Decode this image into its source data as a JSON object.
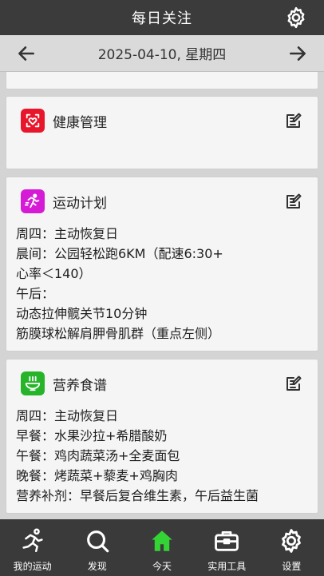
{
  "header": {
    "title": "每日关注"
  },
  "datebar": {
    "date": "2025-04-10, 星期四"
  },
  "cards": [
    {
      "title": "健康管理",
      "badge_color": "#e8162a",
      "lines": []
    },
    {
      "title": "运动计划",
      "badge_color": "#d61bd6",
      "lines": [
        "周四：主动恢复日",
        "晨间：公园轻松跑6KM（配速6:30+",
        "心率＜140）",
        "午后：",
        "动态拉伸髋关节10分钟",
        "筋膜球松解肩胛骨肌群（重点左侧）"
      ]
    },
    {
      "title": "营养食谱",
      "badge_color": "#27b42b",
      "lines": [
        "周四：主动恢复日",
        "早餐：水果沙拉+希腊酸奶",
        "午餐：鸡肉蔬菜汤+全麦面包",
        "晚餐：烤蔬菜+藜麦+鸡胸肉",
        "营养补剂：早餐后复合维生素，午后益生菌"
      ]
    }
  ],
  "nav": [
    {
      "label": "我的运动",
      "icon": "runner-icon"
    },
    {
      "label": "发现",
      "icon": "search-icon"
    },
    {
      "label": "今天",
      "icon": "home-icon",
      "active": true
    },
    {
      "label": "实用工具",
      "icon": "toolbox-icon"
    },
    {
      "label": "设置",
      "icon": "gear-icon"
    }
  ],
  "colors": {
    "active_nav": "#35d235",
    "topbar": "#3b3b3b"
  }
}
